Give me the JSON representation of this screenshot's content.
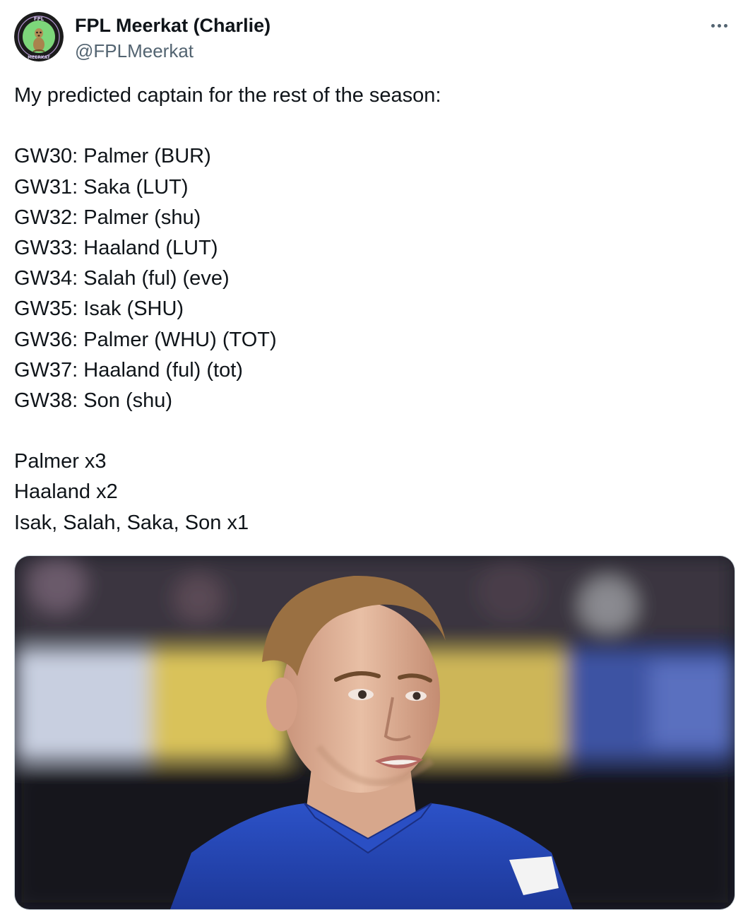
{
  "author": {
    "display_name": "FPL Meerkat (Charlie)",
    "handle": "@FPLMeerkat",
    "avatar_icon": "meerkat-avatar-icon",
    "avatar_colors": {
      "ring": "#1c1c1c",
      "inner": "#7dd67a"
    }
  },
  "more_icon": "more-horizontal-icon",
  "tweet": {
    "intro": "My predicted captain for the rest of the season:",
    "picks": [
      "GW30: Palmer (BUR)",
      "GW31: Saka (LUT)",
      "GW32: Palmer (shu)",
      "GW33: Haaland (LUT)",
      "GW34: Salah (ful) (eve)",
      "GW35: Isak (SHU)",
      "GW36: Palmer (WHU) (TOT)",
      "GW37: Haaland (ful) (tot)",
      "GW38: Son (shu)"
    ],
    "summary": [
      "Palmer x3",
      "Haaland x2",
      "Isak, Salah, Saka, Son x1"
    ]
  },
  "media": {
    "subject": "photo of footballer in blue kit",
    "colors": {
      "background_dark": "#1a1a22",
      "stand_yellow": "#c9b24a",
      "stand_blue": "#3a4f9a",
      "kit_blue": "#2747b8",
      "skin": "#e2b49a",
      "hair": "#9a7042"
    }
  },
  "colors": {
    "text_primary": "#0f1419",
    "text_secondary": "#536471",
    "border": "#cfd9de"
  }
}
